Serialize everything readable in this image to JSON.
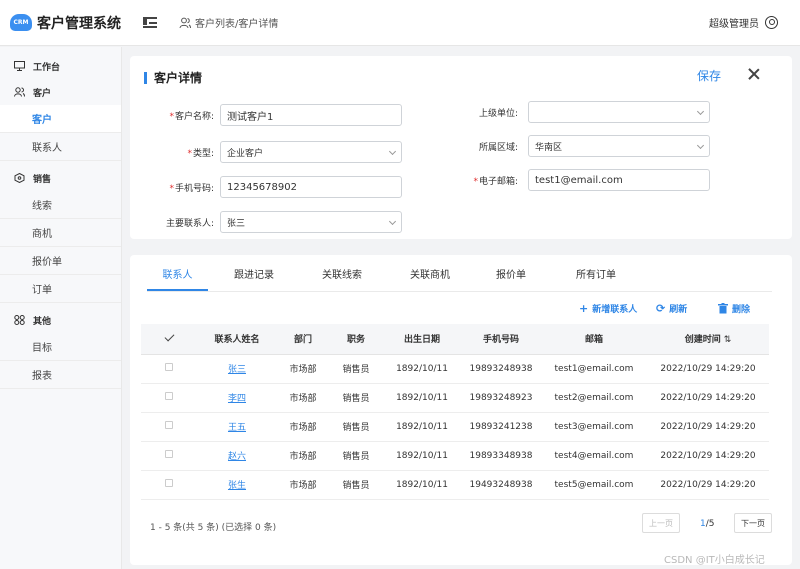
{
  "app": {
    "logo_text": "CRM",
    "title": "客户管理系统",
    "user": "超级管理员"
  },
  "breadcrumb": "客户列表/客户详情",
  "sidebar": {
    "groups": [
      {
        "label": "工作台",
        "items": []
      },
      {
        "label": "客户",
        "items": [
          "客户",
          "联系人"
        ]
      },
      {
        "label": "销售",
        "items": [
          "线索",
          "商机",
          "报价单",
          "订单"
        ]
      },
      {
        "label": "其他",
        "items": [
          "目标",
          "报表"
        ]
      }
    ],
    "active_item": "客户"
  },
  "detail": {
    "title": "客户详情",
    "save_label": "保存",
    "fields": {
      "name": {
        "label": "客户名称:",
        "value": "测试客户1",
        "required": true
      },
      "type": {
        "label": "类型:",
        "value": "企业客户",
        "required": true
      },
      "phone": {
        "label": "手机号码:",
        "value": "12345678902",
        "required": true
      },
      "main_contact": {
        "label": "主要联系人:",
        "value": "张三",
        "required": false
      },
      "parent_org": {
        "label": "上级单位:",
        "value": "",
        "required": false
      },
      "region": {
        "label": "所属区域:",
        "value": "华南区",
        "required": false
      },
      "email": {
        "label": "电子邮箱:",
        "value": "test1@email.com",
        "required": true
      }
    }
  },
  "tabs": [
    "联系人",
    "跟进记录",
    "关联线索",
    "关联商机",
    "报价单",
    "所有订单"
  ],
  "toolbar": {
    "add": "新增联系人",
    "refresh": "刷新",
    "delete": "删除"
  },
  "table": {
    "columns": [
      "联系人姓名",
      "部门",
      "职务",
      "出生日期",
      "手机号码",
      "邮箱",
      "创建时间"
    ],
    "rows": [
      [
        "张三",
        "市场部",
        "销售员",
        "1892/10/11",
        "19893248938",
        "test1@email.com",
        "2022/10/29 14:29:20"
      ],
      [
        "李四",
        "市场部",
        "销售员",
        "1892/10/11",
        "19893248923",
        "test2@email.com",
        "2022/10/29 14:29:20"
      ],
      [
        "王五",
        "市场部",
        "销售员",
        "1892/10/11",
        "19893241238",
        "test3@email.com",
        "2022/10/29 14:29:20"
      ],
      [
        "赵六",
        "市场部",
        "销售员",
        "1892/10/11",
        "19893348938",
        "test4@email.com",
        "2022/10/29 14:29:20"
      ],
      [
        "张生",
        "市场部",
        "销售员",
        "1892/10/11",
        "19493248938",
        "test5@email.com",
        "2022/10/29 14:29:20"
      ]
    ]
  },
  "pagination": {
    "summary": "1 - 5 条(共 5 条) (已选择 0 条)",
    "prev": "上一页",
    "next": "下一页",
    "current": "1",
    "total": "/5"
  },
  "footer_mark": "CSDN @IT小白成长记",
  "colors": {
    "accent": "#2f86e6",
    "required": "#e03030"
  }
}
